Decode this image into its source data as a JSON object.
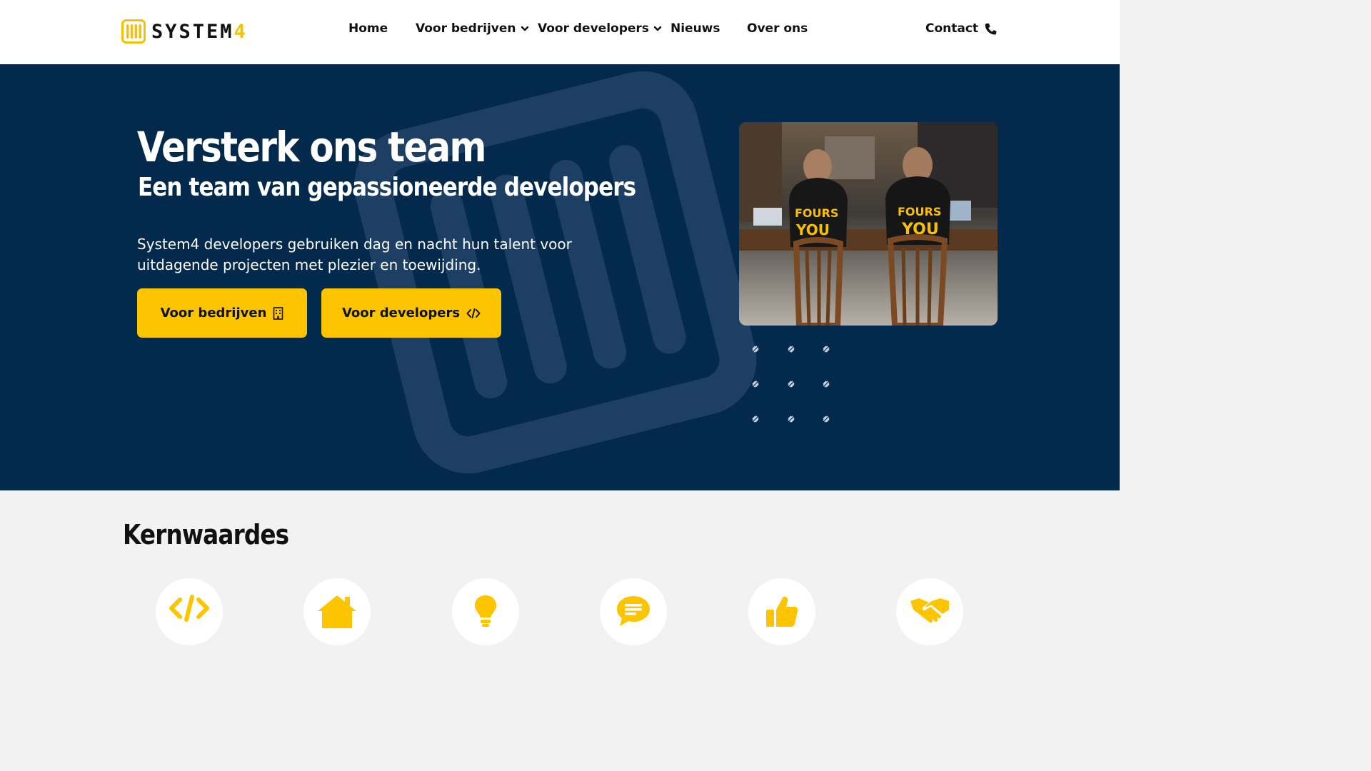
{
  "header": {
    "logo_text": "SYSTEM",
    "logo_digit": "4",
    "nav": [
      {
        "label": "Home",
        "has_dropdown": false
      },
      {
        "label": "Voor bedrijven",
        "has_dropdown": true
      },
      {
        "label": "Voor developers",
        "has_dropdown": true
      },
      {
        "label": "Nieuws",
        "has_dropdown": false
      },
      {
        "label": "Over ons",
        "has_dropdown": false
      }
    ],
    "contact_label": "Contact"
  },
  "hero": {
    "title": "Versterk ons team",
    "subtitle": "Een team van gepassioneerde developers",
    "text": "System4 developers gebruiken dag en nacht hun talent voor uitdagende projecten met plezier en toewijding.",
    "buttons": [
      {
        "label": "Voor bedrijven",
        "icon": "building-icon"
      },
      {
        "label": "Voor developers",
        "icon": "code-icon"
      }
    ]
  },
  "values": {
    "title": "Kernwaardes",
    "icons": [
      "code-icon",
      "home-icon",
      "lightbulb-icon",
      "chat-icon",
      "thumbs-up-icon",
      "handshake-icon"
    ]
  },
  "colors": {
    "accent": "#fcc500",
    "hero_bg": "#03294d",
    "header_bg": "#ffffff",
    "section_bg": "#f2f2f2"
  }
}
